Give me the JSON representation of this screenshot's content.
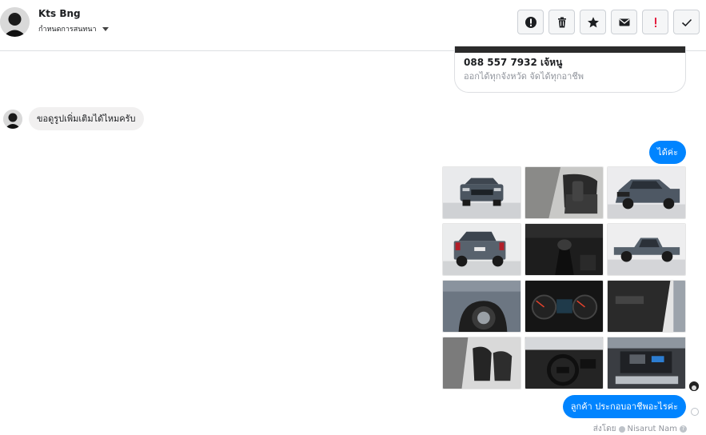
{
  "header": {
    "contact_name": "Kts Bng",
    "status_label": "กำหนดการสนทนา",
    "actions": [
      {
        "name": "report-icon",
        "label": "report"
      },
      {
        "name": "trash-icon",
        "label": "delete"
      },
      {
        "name": "star-icon",
        "label": "star"
      },
      {
        "name": "mail-icon",
        "label": "mark unread"
      },
      {
        "name": "exclamation-icon",
        "label": "important"
      },
      {
        "name": "check-icon",
        "label": "done"
      }
    ]
  },
  "card": {
    "title": "088 557 7932 เจ้หนู",
    "subtitle": "ออกได้ทุกจังหวัด จัดได้ทุกอาชีพ"
  },
  "messages": {
    "incoming_1": "ขอดูรูปเพิ่มเติมได้ไหมครับ",
    "outgoing_1": "ได้ค่ะ",
    "outgoing_2": "ลูกค้า ประกอบอาชีพอะไรค่ะ"
  },
  "photos": [
    {
      "name": "photo-truck-front"
    },
    {
      "name": "photo-rear-seats"
    },
    {
      "name": "photo-truck-front-angle"
    },
    {
      "name": "photo-truck-rear"
    },
    {
      "name": "photo-gear-shifter"
    },
    {
      "name": "photo-truck-side"
    },
    {
      "name": "photo-wheel-arch"
    },
    {
      "name": "photo-dashboard-gauges"
    },
    {
      "name": "photo-door-panel"
    },
    {
      "name": "photo-front-seats"
    },
    {
      "name": "photo-steering-wheel"
    },
    {
      "name": "photo-engine-bay"
    }
  ],
  "footer": {
    "sent_by_prefix": "ส่งโดย",
    "sent_by_name": "Nisarut Nam",
    "help": "?"
  },
  "colors": {
    "accent": "#0084ff",
    "incoming_bubble": "#f1f0f0",
    "border": "#dddfe2"
  }
}
